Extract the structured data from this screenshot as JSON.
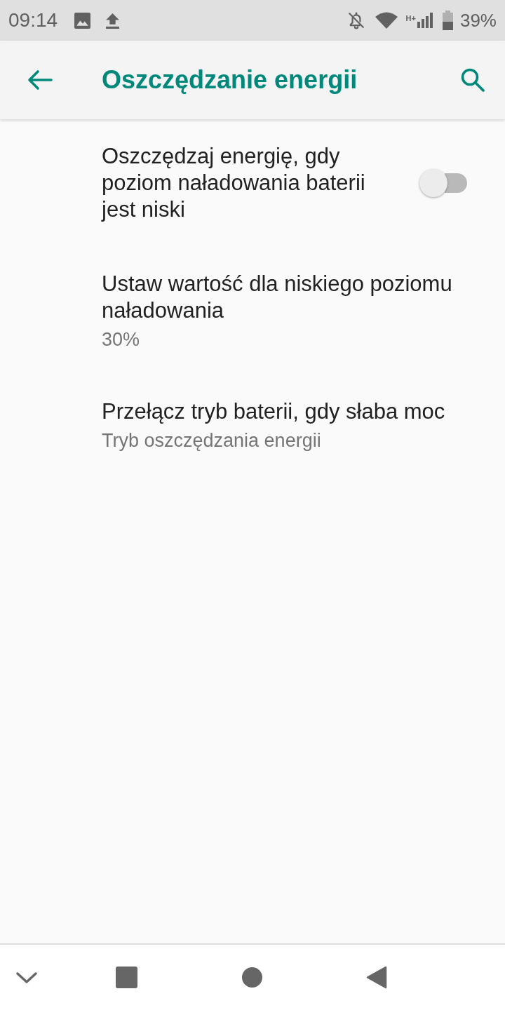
{
  "status_bar": {
    "time": "09:14",
    "network": "H+",
    "battery": "39%"
  },
  "toolbar": {
    "title": "Oszczędzanie energii"
  },
  "settings": [
    {
      "kind": "switch",
      "title": "Oszczędzaj energię, gdy poziom naładowania baterii jest niski",
      "on": false
    },
    {
      "kind": "text",
      "title": "Ustaw wartość dla niskiego poziomu naładowania",
      "summary": "30%"
    },
    {
      "kind": "text",
      "title": "Przełącz tryb baterii, gdy słaba moc",
      "summary": "Tryb oszczędzania energii"
    }
  ]
}
